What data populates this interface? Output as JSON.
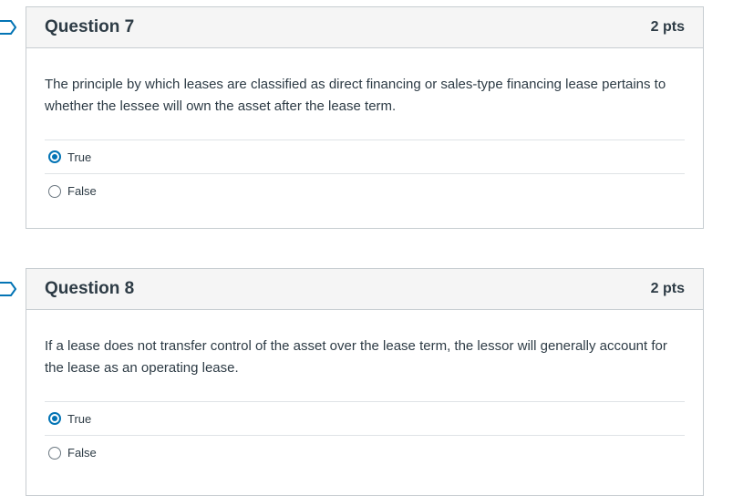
{
  "questions": [
    {
      "title": "Question 7",
      "points": "2 pts",
      "text": "The principle by which leases are classified as direct financing or sales-type financing lease pertains to whether the lessee will own the asset after the lease term.",
      "answers": [
        {
          "label": "True",
          "selected": true
        },
        {
          "label": "False",
          "selected": false
        }
      ]
    },
    {
      "title": "Question 8",
      "points": "2 pts",
      "text": "If a lease does not transfer control of the asset over the lease term, the lessor will generally account for the lease as an operating lease.",
      "answers": [
        {
          "label": "True",
          "selected": true
        },
        {
          "label": "False",
          "selected": false
        }
      ]
    }
  ],
  "colors": {
    "accent": "#0374b5",
    "border": "#c7cdd1",
    "header_bg": "#f5f5f5",
    "text": "#2d3b45"
  }
}
